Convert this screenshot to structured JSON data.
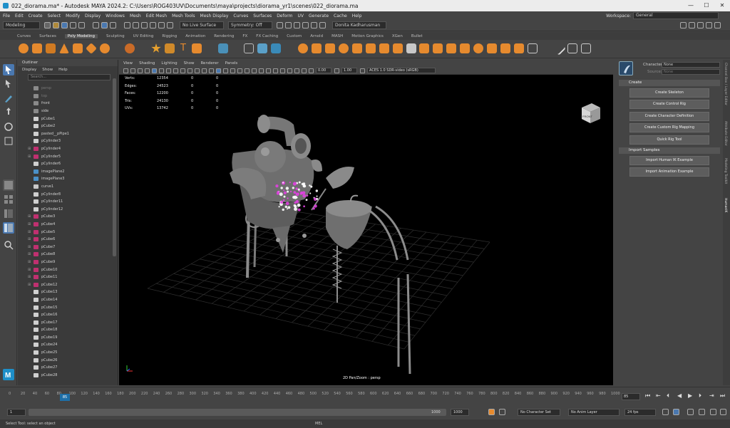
{
  "window": {
    "title": "022_diorama.ma* - Autodesk MAYA 2024.2: C:\\Users\\ROG403UV\\Documents\\maya\\projects\\diorama_yr1\\scenes\\022_diorama.ma",
    "minimize": "—",
    "maximize": "☐",
    "close": "✕"
  },
  "menubar": {
    "items": [
      "File",
      "Edit",
      "Create",
      "Select",
      "Modify",
      "Display",
      "Windows",
      "Mesh",
      "Edit Mesh",
      "Mesh Tools",
      "Mesh Display",
      "Curves",
      "Surfaces",
      "Deform",
      "UV",
      "Generate",
      "Cache",
      "Help"
    ],
    "workspace_label": "Workspace:",
    "workspace_value": "General"
  },
  "statusline": {
    "menuset": "Modeling",
    "live_surface": "No Live Surface",
    "symmetry": "Symmetry: Off",
    "user": "Donita Kadharusman"
  },
  "shelf": {
    "tabs": [
      "Curves",
      "Surfaces",
      "Poly Modeling",
      "Sculpting",
      "UV Editing",
      "Rigging",
      "Animation",
      "Rendering",
      "FX",
      "FX Caching",
      "Custom",
      "Arnold",
      "MASH",
      "Motion Graphics",
      "XGen",
      "Bullet"
    ],
    "active_tab": "Poly Modeling"
  },
  "outliner": {
    "title": "Outliner",
    "menu": [
      "Display",
      "Show",
      "Help"
    ],
    "search_placeholder": "Search...",
    "items": [
      {
        "name": "persp",
        "type": "camera",
        "dim": true,
        "expand": ""
      },
      {
        "name": "top",
        "type": "camera",
        "dim": true,
        "expand": ""
      },
      {
        "name": "front",
        "type": "camera",
        "dim": false,
        "expand": ""
      },
      {
        "name": "side",
        "type": "camera",
        "dim": false,
        "expand": ""
      },
      {
        "name": "pCube1",
        "type": "mesh",
        "dim": false,
        "expand": ""
      },
      {
        "name": "pCube2",
        "type": "mesh",
        "dim": false,
        "expand": ""
      },
      {
        "name": "pasted__pPipe1",
        "type": "mesh",
        "dim": false,
        "expand": ""
      },
      {
        "name": "pCylinder3",
        "type": "mesh",
        "dim": false,
        "expand": ""
      },
      {
        "name": "pCylinder4",
        "type": "group",
        "dim": false,
        "expand": "⊞"
      },
      {
        "name": "pCylinder5",
        "type": "group",
        "dim": false,
        "expand": "⊞"
      },
      {
        "name": "pCylinder6",
        "type": "mesh",
        "dim": false,
        "expand": ""
      },
      {
        "name": "imagePlane2",
        "type": "image",
        "dim": false,
        "expand": ""
      },
      {
        "name": "imagePlane3",
        "type": "image",
        "dim": false,
        "expand": ""
      },
      {
        "name": "curve1",
        "type": "curve",
        "dim": false,
        "expand": ""
      },
      {
        "name": "pCylinder8",
        "type": "mesh",
        "dim": false,
        "expand": ""
      },
      {
        "name": "pCylinder11",
        "type": "mesh",
        "dim": false,
        "expand": ""
      },
      {
        "name": "pCylinder12",
        "type": "mesh",
        "dim": false,
        "expand": ""
      },
      {
        "name": "pCube3",
        "type": "group",
        "dim": false,
        "expand": "⊞"
      },
      {
        "name": "pCube4",
        "type": "group",
        "dim": false,
        "expand": "⊞"
      },
      {
        "name": "pCube5",
        "type": "group",
        "dim": false,
        "expand": "⊞"
      },
      {
        "name": "pCube6",
        "type": "group",
        "dim": false,
        "expand": "⊞"
      },
      {
        "name": "pCube7",
        "type": "group",
        "dim": false,
        "expand": "⊞"
      },
      {
        "name": "pCube8",
        "type": "group",
        "dim": false,
        "expand": "⊞"
      },
      {
        "name": "pCube9",
        "type": "group",
        "dim": false,
        "expand": "⊞"
      },
      {
        "name": "pCube10",
        "type": "group",
        "dim": false,
        "expand": "⊞"
      },
      {
        "name": "pCube11",
        "type": "group",
        "dim": false,
        "expand": "⊞"
      },
      {
        "name": "pCube12",
        "type": "group",
        "dim": false,
        "expand": "⊞"
      },
      {
        "name": "pCube13",
        "type": "mesh",
        "dim": false,
        "expand": ""
      },
      {
        "name": "pCube14",
        "type": "mesh",
        "dim": false,
        "expand": ""
      },
      {
        "name": "pCube15",
        "type": "mesh",
        "dim": false,
        "expand": ""
      },
      {
        "name": "pCube16",
        "type": "mesh",
        "dim": false,
        "expand": ""
      },
      {
        "name": "pCube17",
        "type": "mesh",
        "dim": false,
        "expand": ""
      },
      {
        "name": "pCube18",
        "type": "mesh",
        "dim": false,
        "expand": ""
      },
      {
        "name": "pCube19",
        "type": "mesh",
        "dim": false,
        "expand": ""
      },
      {
        "name": "pCube24",
        "type": "mesh",
        "dim": false,
        "expand": ""
      },
      {
        "name": "pCube25",
        "type": "mesh",
        "dim": false,
        "expand": ""
      },
      {
        "name": "pCube26",
        "type": "mesh",
        "dim": false,
        "expand": ""
      },
      {
        "name": "pCube27",
        "type": "mesh",
        "dim": false,
        "expand": ""
      },
      {
        "name": "pCube28",
        "type": "mesh",
        "dim": false,
        "expand": ""
      }
    ]
  },
  "viewport": {
    "menu": [
      "View",
      "Shading",
      "Lighting",
      "Show",
      "Renderer",
      "Panels"
    ],
    "field_a": "0.00",
    "field_b": "1.00",
    "colorspace": "ACES 1.0 SDR-video (sRGB)",
    "hud": [
      {
        "label": "Verts:",
        "v1": "12354",
        "v2": "0",
        "v3": "0"
      },
      {
        "label": "Edges:",
        "v1": "24523",
        "v2": "0",
        "v3": "0"
      },
      {
        "label": "Faces:",
        "v1": "12200",
        "v2": "0",
        "v3": "0"
      },
      {
        "label": "Tris:",
        "v1": "24130",
        "v2": "0",
        "v3": "0"
      },
      {
        "label": "UVs:",
        "v1": "13742",
        "v2": "0",
        "v3": "0"
      }
    ],
    "camera_label": "2D Pan/Zoom : persp",
    "viewcube_label": "FRONT"
  },
  "humanik": {
    "character_label": "Character:",
    "character_value": "None",
    "source_label": "Source:",
    "source_value": "None",
    "create_section": "Create",
    "create_buttons": [
      "Create Skeleton",
      "Create Control Rig",
      "Create Character Definition",
      "Create Custom Rig Mapping",
      "Quick Rig Tool"
    ],
    "import_section": "Import Samples",
    "import_buttons": [
      "Import Human IK Example",
      "Import Animation Example"
    ],
    "side_tabs": [
      "Channel Box / Layer Editor",
      "Attribute Editor",
      "Modeling Toolkit",
      "HumanIK"
    ]
  },
  "timeslider": {
    "ticks": [
      "0",
      "20",
      "40",
      "60",
      "80",
      "100",
      "120",
      "140",
      "160",
      "180",
      "200",
      "220",
      "240",
      "260",
      "280",
      "300",
      "320",
      "340",
      "360",
      "380",
      "400",
      "420",
      "440",
      "460",
      "480",
      "500",
      "520",
      "540",
      "560",
      "580",
      "600",
      "620",
      "640",
      "660",
      "680",
      "700",
      "720",
      "740",
      "760",
      "780",
      "800",
      "820",
      "840",
      "860",
      "880",
      "900",
      "920",
      "940",
      "960",
      "980",
      "1000"
    ],
    "current_frame": "85",
    "current_field": "85"
  },
  "range": {
    "start": "1",
    "end_inner": "1000",
    "end_outer": "1000",
    "character_set": "No Character Set",
    "anim_layer": "No Anim Layer",
    "fps": "24 fps"
  },
  "helpline": {
    "text": "Select Tool: select an object",
    "mel_label": "MEL"
  },
  "colors": {
    "accent_blue": "#1e6fa8",
    "selection_magenta": "#e040e0",
    "shelf_orange": "#e68a2e",
    "scene_bg": "#000000",
    "mesh_grey": "#8c8c8c",
    "maya_teal": "#1e8fc9"
  }
}
